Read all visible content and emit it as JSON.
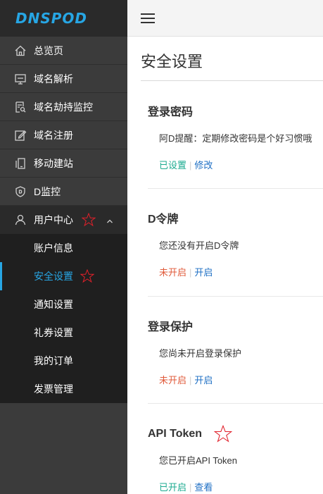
{
  "logo": "DNSPOD",
  "sidebar": {
    "items": [
      {
        "label": "总览页",
        "icon": "home-icon"
      },
      {
        "label": "域名解析",
        "icon": "monitor-icon"
      },
      {
        "label": "域名劫持监控",
        "icon": "search-document-icon"
      },
      {
        "label": "域名注册",
        "icon": "edit-icon"
      },
      {
        "label": "移动建站",
        "icon": "mobile-icon"
      },
      {
        "label": "D监控",
        "icon": "shield-icon"
      },
      {
        "label": "用户中心",
        "icon": "user-icon",
        "expanded": true
      }
    ],
    "submenu": [
      {
        "label": "账户信息"
      },
      {
        "label": "安全设置",
        "active": true
      },
      {
        "label": "通知设置"
      },
      {
        "label": "礼券设置"
      },
      {
        "label": "我的订单"
      },
      {
        "label": "发票管理"
      }
    ]
  },
  "header": {
    "menu_icon": "hamburger-icon"
  },
  "main": {
    "title": "安全设置",
    "sections": [
      {
        "title": "登录密码",
        "desc": "阿D提醒：定期修改密码是个好习惯哦",
        "status": "已设置",
        "action": "修改"
      },
      {
        "title": "D令牌",
        "desc": "您还没有开启D令牌",
        "status": "未开启",
        "action": "开启"
      },
      {
        "title": "登录保护",
        "desc": "您尚未开启登录保护",
        "status": "未开启",
        "action": "开启"
      },
      {
        "title": "API Token",
        "desc": "您已开启API Token",
        "status": "已开启",
        "action": "查看"
      }
    ]
  },
  "colors": {
    "accent": "#27a6e4",
    "enabled": "#1aaa8f",
    "disabled": "#e05a3a",
    "link": "#1e6fc4",
    "annotation_star": "#e0202a"
  }
}
